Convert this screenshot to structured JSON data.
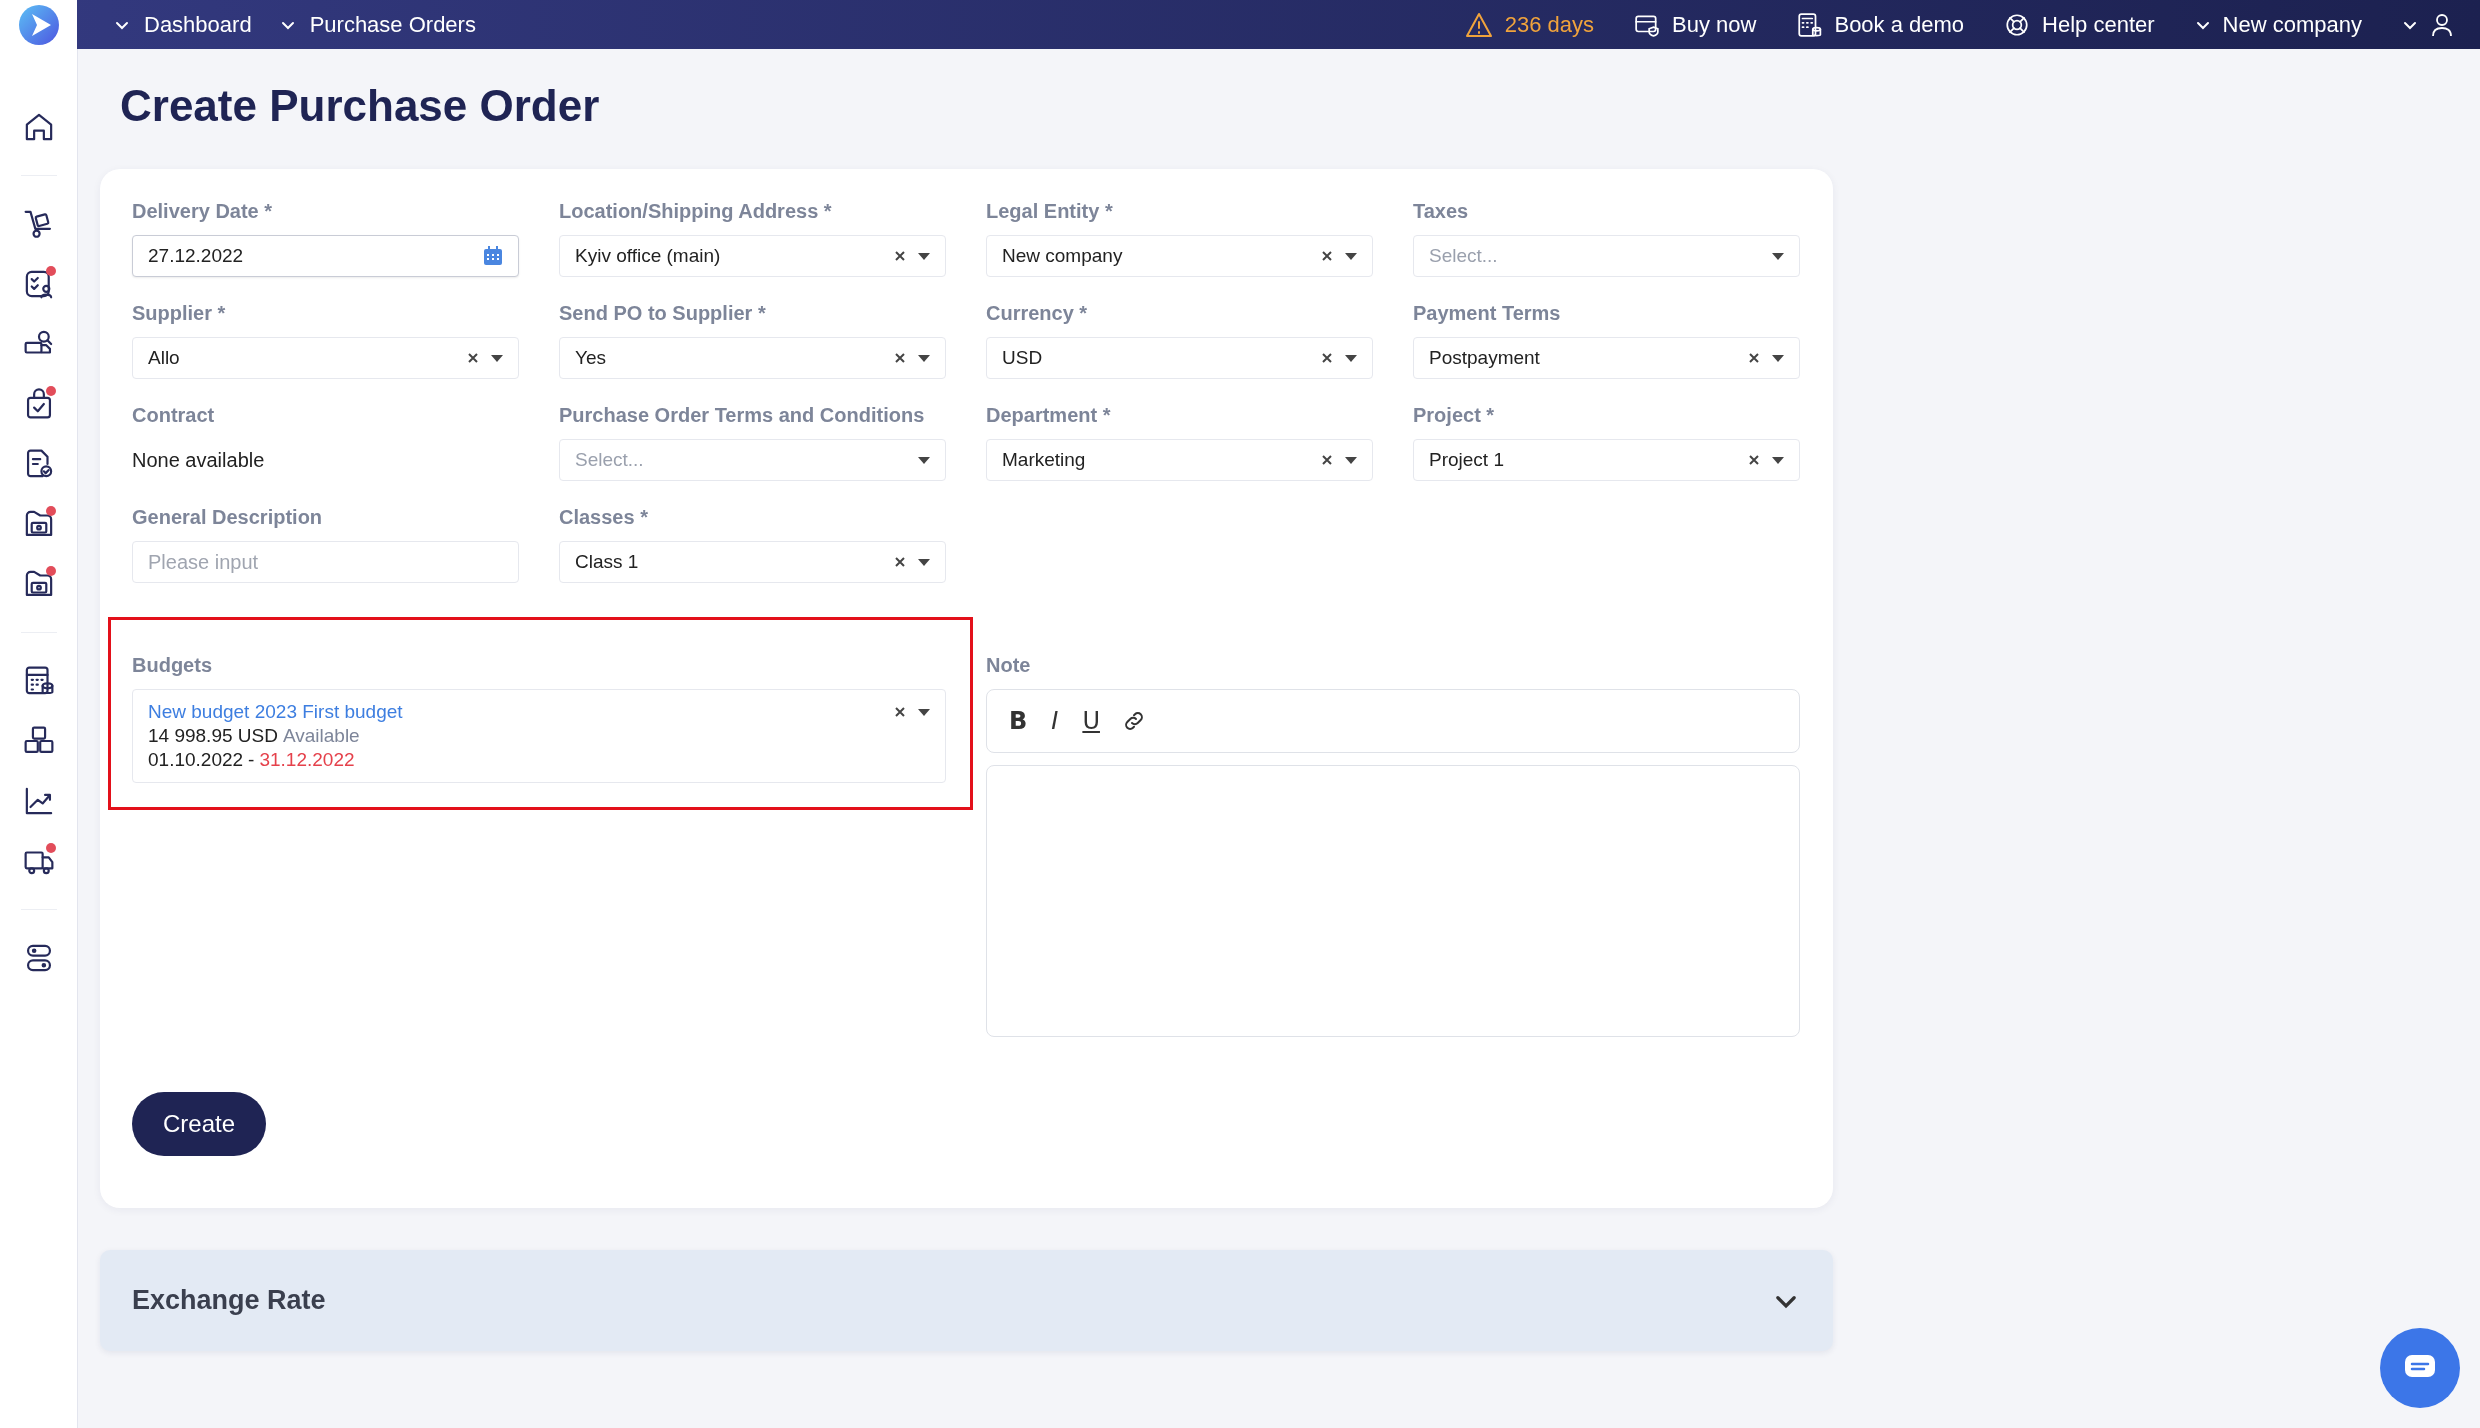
{
  "topbar": {
    "breadcrumbs": [
      {
        "label": "Dashboard"
      },
      {
        "label": "Purchase Orders"
      }
    ],
    "trial": "236 days",
    "links": [
      {
        "label": "Buy now"
      },
      {
        "label": "Book a demo"
      },
      {
        "label": "Help center"
      }
    ],
    "company": "New company"
  },
  "sidebar": {
    "groups": [
      {
        "items": [
          {
            "alert": false
          }
        ]
      },
      {
        "items": [
          {
            "alert": false
          },
          {
            "alert": true
          },
          {
            "alert": false
          },
          {
            "alert": true
          },
          {
            "alert": false
          },
          {
            "alert": true
          },
          {
            "alert": true
          }
        ]
      },
      {
        "items": [
          {
            "alert": false
          },
          {
            "alert": false
          },
          {
            "alert": false
          },
          {
            "alert": true
          }
        ]
      },
      {
        "items": [
          {
            "alert": false
          }
        ]
      }
    ]
  },
  "page": {
    "title": "Create Purchase Order"
  },
  "form": {
    "fields": [
      {
        "kind": "date",
        "label": "Delivery Date *",
        "value": "27.12.2022"
      },
      {
        "kind": "select",
        "label": "Location/Shipping Address *",
        "value": "Kyiv office (main)"
      },
      {
        "kind": "select",
        "label": "Legal Entity *",
        "value": "New company"
      },
      {
        "kind": "select",
        "label": "Taxes",
        "placeholder": "Select..."
      },
      {
        "kind": "select",
        "label": "Supplier *",
        "value": "Allo"
      },
      {
        "kind": "select",
        "label": "Send PO to Supplier *",
        "value": "Yes"
      },
      {
        "kind": "select",
        "label": "Currency *",
        "value": "USD"
      },
      {
        "kind": "select",
        "label": "Payment Terms",
        "value": "Postpayment"
      },
      {
        "kind": "static",
        "label": "Contract",
        "value": "None available"
      },
      {
        "kind": "select",
        "label": "Purchase Order Terms and Conditions",
        "placeholder": "Select..."
      },
      {
        "kind": "select",
        "label": "Department *",
        "value": "Marketing"
      },
      {
        "kind": "select",
        "label": "Project *",
        "value": "Project 1"
      },
      {
        "kind": "input",
        "label": "General Description",
        "placeholder": "Please input"
      },
      {
        "kind": "select",
        "label": "Classes *",
        "value": "Class 1"
      }
    ],
    "budgets": {
      "label": "Budgets",
      "name": "New budget 2023 First budget",
      "amount": "14 998.95 USD",
      "available": "Available",
      "start": "01.10.2022",
      "dash": "-",
      "end": "31.12.2022"
    },
    "note": {
      "label": "Note",
      "tools": [
        "B",
        "I",
        "U"
      ]
    },
    "submit": "Create"
  },
  "exchange": {
    "title": "Exchange Rate",
    "expanded": false
  }
}
